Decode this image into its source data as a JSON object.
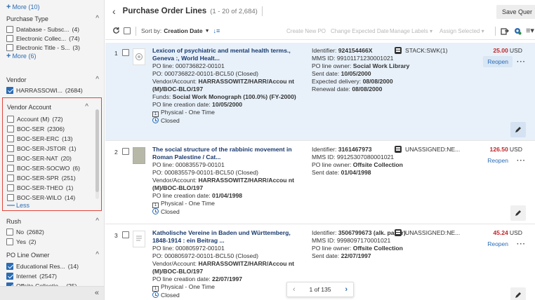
{
  "sidebar": {
    "top_more": "More (10)",
    "purchase_type": {
      "title": "Purchase Type",
      "items": [
        {
          "label": "Database - Subsc...",
          "count": "(4)"
        },
        {
          "label": "Electronic Collec...",
          "count": "(74)"
        },
        {
          "label": "Electronic Title - S...",
          "count": "(3)"
        }
      ],
      "more": "More (6)"
    },
    "vendor": {
      "title": "Vendor",
      "items": [
        {
          "label": "HARRASSOWI...",
          "count": "(2684)",
          "checked": true
        }
      ]
    },
    "vendor_account": {
      "title": "Vendor Account",
      "items": [
        {
          "label": "Account (M)",
          "count": "(72)"
        },
        {
          "label": "BOC-SER",
          "count": "(2306)"
        },
        {
          "label": "BOC-SER-ERC",
          "count": "(13)"
        },
        {
          "label": "BOC-SER-JSTOR",
          "count": "(1)"
        },
        {
          "label": "BOC-SER-NAT",
          "count": "(20)"
        },
        {
          "label": "BOC-SER-SOCWO",
          "count": "(6)"
        },
        {
          "label": "BOC-SER-SPR",
          "count": "(251)"
        },
        {
          "label": "BOC-SER-THEO",
          "count": "(1)"
        },
        {
          "label": "BOC-SER-WILO",
          "count": "(14)"
        }
      ],
      "less": "Less"
    },
    "rush": {
      "title": "Rush",
      "items": [
        {
          "label": "No",
          "count": "(2682)"
        },
        {
          "label": "Yes",
          "count": "(2)"
        }
      ]
    },
    "po_line_owner": {
      "title": "PO Line Owner",
      "items": [
        {
          "label": "Educational Res...",
          "count": "(14)",
          "checked": true
        },
        {
          "label": "Internet",
          "count": "(2547)",
          "checked": true
        },
        {
          "label": "Offsite Collectio...",
          "count": "(25)",
          "checked": true
        }
      ]
    },
    "collapse_icon": "double-chevron-left-icon"
  },
  "header": {
    "title": "Purchase Order Lines",
    "count": "(1 - 20 of 2,684)",
    "save_query": "Save Quer"
  },
  "toolbar": {
    "sort_label": "Sort by:",
    "sort_value": "Creation Date",
    "create_new_po": "Create New PO",
    "change_expected_date": "Change Expected Date",
    "manage_labels": "Manage Labels",
    "assign_selected": "Assign Selected"
  },
  "rows": [
    {
      "num": "1",
      "title": "Lexicon of psychiatric and mental health terms., Geneva :, World Healt...",
      "po_line_label": "PO line:",
      "po_line": "000736822-00101",
      "po_label": "PO:",
      "po": "000736822-00101-BCL50 (Closed)",
      "vendor_label": "Vendor/Account:",
      "vendor": "HARRASSOWITZ/HARR/Accou nt (M)/BOC-BLO/197",
      "funds_label": "Funds:",
      "funds": "Social Work Monograph (100.0%) (FY-2000)",
      "creation_label": "PO line creation date:",
      "creation": "10/05/2000",
      "type": "Physical - One Time",
      "status": "Closed",
      "identifier_label": "Identifier:",
      "identifier": "924154466X",
      "mms_label": "MMS ID:",
      "mms": "99101171230001021",
      "owner_label": "PO line owner:",
      "owner": "Social Work Library",
      "sent_label": "Sent date:",
      "sent": "10/05/2000",
      "expected_label": "Expected delivery:",
      "expected": "08/08/2000",
      "renewal_label": "Renewal date:",
      "renewal": "08/08/2000",
      "location": "STACK:SWK(1)",
      "price": "25.00",
      "currency": "USD",
      "reopen": "Reopen"
    },
    {
      "num": "2",
      "title": "The social structure of the rabbinic movement in Roman Palestine / Cat...",
      "po_line_label": "PO line:",
      "po_line": "000835579-00101",
      "po_label": "PO:",
      "po": "000835579-00101-BCL50 (Closed)",
      "vendor_label": "Vendor/Account:",
      "vendor": "HARRASSOWITZ/HARR/Accou nt (M)/BOC-BLO/197",
      "creation_label": "PO line creation date:",
      "creation": "01/04/1998",
      "type": "Physical - One Time",
      "status": "Closed",
      "identifier_label": "Identifier:",
      "identifier": "3161467973",
      "mms_label": "MMS ID:",
      "mms": "99125307080001021",
      "owner_label": "PO line owner:",
      "owner": "Offsite Collection",
      "sent_label": "Sent date:",
      "sent": "01/04/1998",
      "location": "UNASSIGNED:NE...",
      "price": "126.50",
      "currency": "USD",
      "reopen": "Reopen"
    },
    {
      "num": "3",
      "title": "Katholische Vereine in Baden und Württemberg, 1848-1914 : ein Beitrag ...",
      "po_line_label": "PO line:",
      "po_line": "000805972-00101",
      "po_label": "PO:",
      "po": "000805972-00101-BCL50 (Closed)",
      "vendor_label": "Vendor/Account:",
      "vendor": "HARRASSOWITZ/HARR/Accou nt (M)/BOC-BLO/197",
      "creation_label": "PO line creation date:",
      "creation": "22/07/1997",
      "type": "Physical - One Time",
      "status": "Closed",
      "identifier_label": "Identifier:",
      "identifier": "3506799673 (alk. paper)",
      "mms_label": "MMS ID:",
      "mms": "9998097170001021",
      "owner_label": "PO line owner:",
      "owner": "Offsite Collection",
      "sent_label": "Sent date:",
      "sent": "22/07/1997",
      "location": "UNASSIGNED:NE...",
      "price": "45.24",
      "currency": "USD",
      "reopen": "Reopen"
    }
  ],
  "pager": {
    "text": "1 of 135"
  },
  "colors": {
    "accent": "#2b6cb3",
    "price": "#c0262a",
    "highlight_border": "#e0453a",
    "selected_row": "#e8f1fa"
  }
}
